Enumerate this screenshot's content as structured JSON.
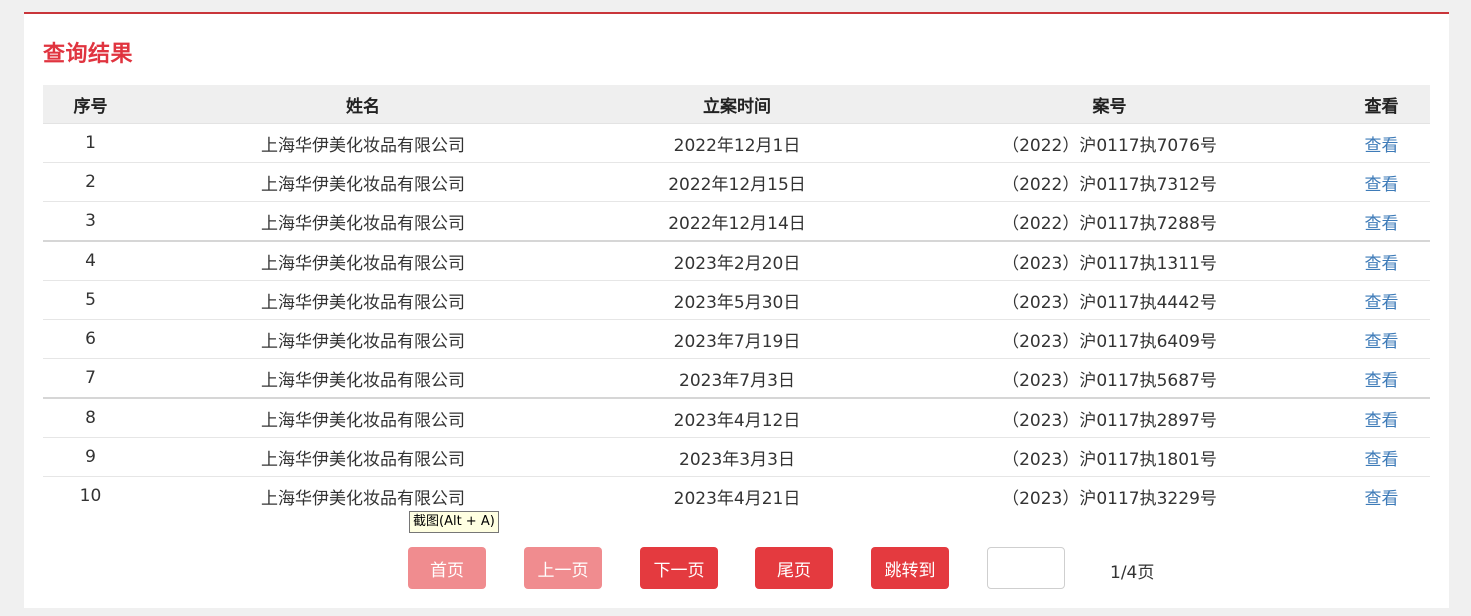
{
  "title": "查询结果",
  "columns": [
    "序号",
    "姓名",
    "立案时间",
    "案号",
    "查看"
  ],
  "rows": [
    {
      "no": "1",
      "name": "上海华伊美化妆品有限公司",
      "date": "2022年12月1日",
      "case": "（2022）沪0117执7076号",
      "view": "查看"
    },
    {
      "no": "2",
      "name": "上海华伊美化妆品有限公司",
      "date": "2022年12月15日",
      "case": "（2022）沪0117执7312号",
      "view": "查看"
    },
    {
      "no": "3",
      "name": "上海华伊美化妆品有限公司",
      "date": "2022年12月14日",
      "case": "（2022）沪0117执7288号",
      "view": "查看"
    },
    {
      "no": "4",
      "name": "上海华伊美化妆品有限公司",
      "date": "2023年2月20日",
      "case": "（2023）沪0117执1311号",
      "view": "查看"
    },
    {
      "no": "5",
      "name": "上海华伊美化妆品有限公司",
      "date": "2023年5月30日",
      "case": "（2023）沪0117执4442号",
      "view": "查看"
    },
    {
      "no": "6",
      "name": "上海华伊美化妆品有限公司",
      "date": "2023年7月19日",
      "case": "（2023）沪0117执6409号",
      "view": "查看"
    },
    {
      "no": "7",
      "name": "上海华伊美化妆品有限公司",
      "date": "2023年7月3日",
      "case": "（2023）沪0117执5687号",
      "view": "查看"
    },
    {
      "no": "8",
      "name": "上海华伊美化妆品有限公司",
      "date": "2023年4月12日",
      "case": "（2023）沪0117执2897号",
      "view": "查看"
    },
    {
      "no": "9",
      "name": "上海华伊美化妆品有限公司",
      "date": "2023年3月3日",
      "case": "（2023）沪0117执1801号",
      "view": "查看"
    },
    {
      "no": "10",
      "name": "上海华伊美化妆品有限公司",
      "date": "2023年4月21日",
      "case": "（2023）沪0117执3229号",
      "view": "查看"
    }
  ],
  "tooltip": "截图(Alt + A)",
  "pager": {
    "first": "首页",
    "prev": "上一页",
    "next": "下一页",
    "last": "尾页",
    "jump": "跳转到",
    "page_input_value": "",
    "page_info": "1/4页"
  },
  "colors": {
    "accent": "#e0343f",
    "button_active": "#e43a3f",
    "button_disabled": "#f08c8f",
    "link": "#3e7bb8"
  }
}
